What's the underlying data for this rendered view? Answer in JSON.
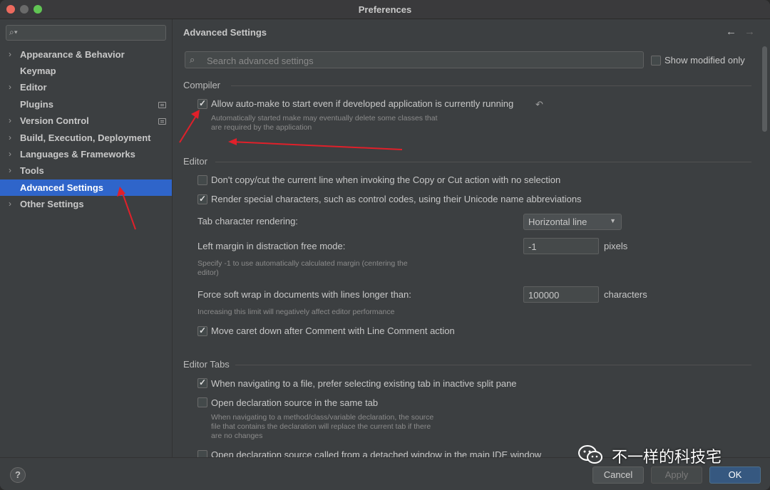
{
  "window": {
    "title": "Preferences"
  },
  "sidebar": {
    "search_placeholder": "",
    "items": [
      {
        "label": "Appearance & Behavior",
        "expandable": true
      },
      {
        "label": "Keymap",
        "expandable": false
      },
      {
        "label": "Editor",
        "expandable": true
      },
      {
        "label": "Plugins",
        "expandable": false
      },
      {
        "label": "Version Control",
        "expandable": true
      },
      {
        "label": "Build, Execution, Deployment",
        "expandable": true
      },
      {
        "label": "Languages & Frameworks",
        "expandable": true
      },
      {
        "label": "Tools",
        "expandable": true
      },
      {
        "label": "Advanced Settings",
        "expandable": false,
        "selected": true
      },
      {
        "label": "Other Settings",
        "expandable": true
      }
    ]
  },
  "main": {
    "title": "Advanced Settings",
    "search_placeholder": "Search advanced settings",
    "show_modified_label": "Show modified only",
    "show_modified_checked": false,
    "sections": {
      "compiler": {
        "title": "Compiler",
        "auto_make": {
          "label": "Allow auto-make to start even if developed application is currently running",
          "checked": true,
          "hint_line1": "Automatically started make may eventually delete some classes that",
          "hint_line2": "are required by the application"
        }
      },
      "editor": {
        "title": "Editor",
        "no_copy_cut": {
          "label": "Don't copy/cut the current line when invoking the Copy or Cut action with no selection",
          "checked": false
        },
        "render_special": {
          "label": "Render special characters, such as control codes, using their Unicode name abbreviations",
          "checked": true
        },
        "tab_rendering": {
          "label": "Tab character rendering:",
          "value": "Horizontal line"
        },
        "left_margin": {
          "label": "Left margin in distraction free mode:",
          "value": "-1",
          "unit": "pixels",
          "hint_line1": "Specify -1 to use automatically calculated margin (centering the",
          "hint_line2": "editor)"
        },
        "soft_wrap": {
          "label": "Force soft wrap in documents with lines longer than:",
          "value": "100000",
          "unit": "characters",
          "hint": "Increasing this limit will negatively affect editor performance"
        },
        "move_caret": {
          "label": "Move caret down after Comment with Line Comment action",
          "checked": true
        }
      },
      "editor_tabs": {
        "title": "Editor Tabs",
        "prefer_existing": {
          "label": "When navigating to a file, prefer selecting existing tab in inactive split pane",
          "checked": true
        },
        "same_tab": {
          "label": "Open declaration source in the same tab",
          "checked": false,
          "hint_line1": "When navigating to a method/class/variable declaration, the source",
          "hint_line2": "file that contains the declaration will replace the current tab if there",
          "hint_line3": "are no changes"
        },
        "detached": {
          "label": "Open declaration source called from a detached window in the main IDE window",
          "checked": false
        }
      }
    }
  },
  "footer": {
    "help_label": "?",
    "cancel_label": "Cancel",
    "apply_label": "Apply",
    "ok_label": "OK"
  },
  "watermark": {
    "text": "不一样的科技宅"
  },
  "colors": {
    "selection": "#2f65ca",
    "ok_button": "#365880",
    "annotation_arrow": "#e0202a"
  }
}
